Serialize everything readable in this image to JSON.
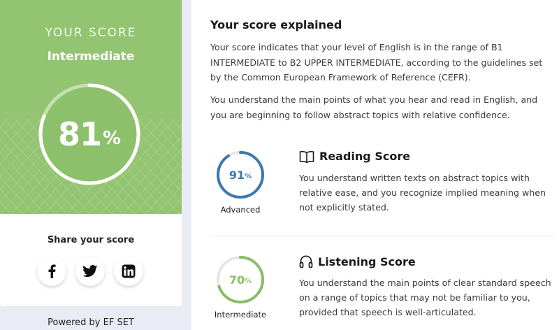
{
  "score_card": {
    "title": "YOUR SCORE",
    "level": "Intermediate",
    "score": "81",
    "score_fraction": 0.81,
    "percent_sign": "%",
    "accent_color": "#93c471"
  },
  "share": {
    "label": "Share your score",
    "icons": [
      "facebook-icon",
      "twitter-icon",
      "linkedin-icon"
    ]
  },
  "footer": {
    "powered_by": "Powered by EF SET"
  },
  "explained": {
    "title": "Your score explained",
    "paragraph1": "Your score indicates that your level of English is in the range of B1 INTERMEDIATE to B2 UPPER INTERMEDIATE, according to the guidelines set by the Common European Framework of Reference (CEFR).",
    "paragraph2": "You understand the main points of what you hear and read in English, and you are beginning to follow abstract topics with relative confidence."
  },
  "reading": {
    "heading": "Reading Score",
    "score": "91",
    "score_fraction": 0.91,
    "percent_sign": "%",
    "level": "Advanced",
    "color": "#3b78b0",
    "description": "You understand written texts on abstract topics with relative ease, and you recognize implied meaning when not explicitly stated."
  },
  "listening": {
    "heading": "Listening Score",
    "score": "70",
    "score_fraction": 0.7,
    "percent_sign": "%",
    "level": "Intermediate",
    "color": "#8bbd67",
    "description": "You understand the main points of clear standard speech on a range of topics that may not be familiar to you, provided that speech is well-articulated."
  }
}
